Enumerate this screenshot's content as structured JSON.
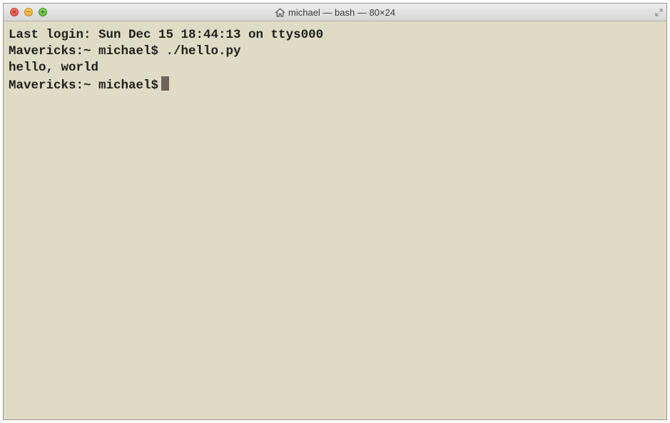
{
  "window": {
    "title": "michael — bash — 80×24",
    "close_glyph": "×",
    "minimize_glyph": "−",
    "maximize_glyph": "+"
  },
  "terminal": {
    "lines": [
      "Last login: Sun Dec 15 18:44:13 on ttys000",
      "Mavericks:~ michael$ ./hello.py",
      "hello, world"
    ],
    "prompt": "Mavericks:~ michael$"
  },
  "colors": {
    "terminal_background": "#e0dbc4",
    "terminal_text": "#1f1f1f",
    "cursor": "#6f625f"
  },
  "icons": {
    "title": "home-icon",
    "corner": "fullscreen-icon"
  }
}
